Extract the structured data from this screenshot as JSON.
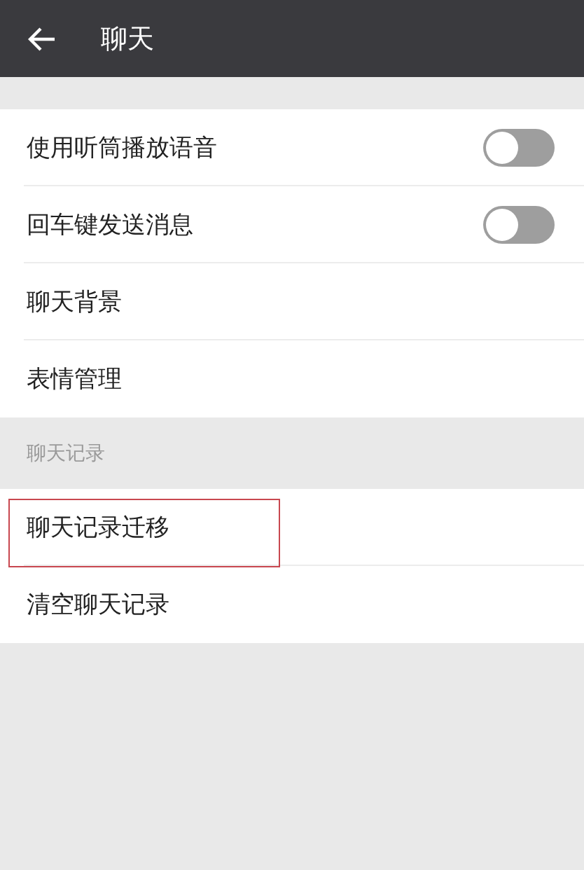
{
  "header": {
    "title": "聊天"
  },
  "groups": [
    {
      "items": [
        {
          "kind": "toggle",
          "label": "使用听筒播放语音",
          "on": false
        },
        {
          "kind": "toggle",
          "label": "回车键发送消息",
          "on": false
        },
        {
          "kind": "link",
          "label": "聊天背景"
        },
        {
          "kind": "link",
          "label": "表情管理"
        }
      ]
    },
    {
      "title": "聊天记录",
      "items": [
        {
          "kind": "link",
          "label": "聊天记录迁移",
          "highlighted": true
        },
        {
          "kind": "link",
          "label": "清空聊天记录",
          "highlighted": false
        }
      ]
    }
  ]
}
